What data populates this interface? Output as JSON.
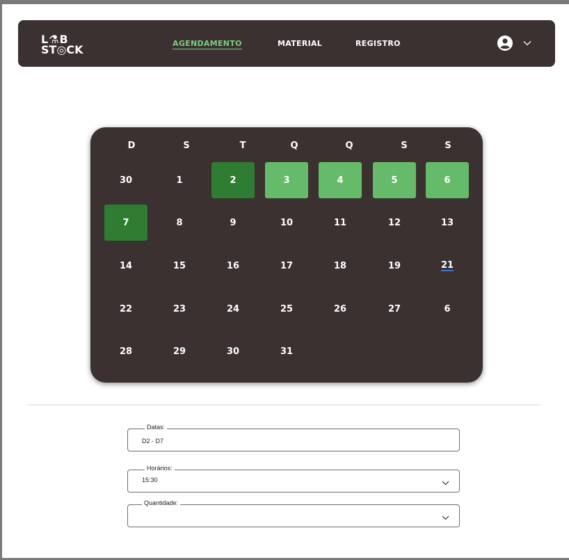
{
  "nav": {
    "logo_line1": "L⚗B",
    "logo_line2": "ST◎CK",
    "links": [
      "AGENDAMENTO",
      "MATERIAL",
      "REGISTRO"
    ]
  },
  "calendar": {
    "weekdays": [
      "D",
      "S",
      "T",
      "Q",
      "Q",
      "S",
      "S"
    ],
    "rows": [
      [
        "30",
        "1",
        "2",
        "3",
        "4",
        "5",
        "6"
      ],
      [
        "7",
        "8",
        "9",
        "10",
        "11",
        "12",
        "13"
      ],
      [
        "14",
        "15",
        "16",
        "17",
        "18",
        "19",
        "21"
      ],
      [
        "22",
        "23",
        "24",
        "25",
        "26",
        "27",
        "6"
      ],
      [
        "28",
        "29",
        "30",
        "31"
      ]
    ],
    "selected_dark": [
      "2",
      "7"
    ],
    "selected_light": [
      "3",
      "4",
      "5",
      "6"
    ],
    "colors": {
      "dark": "#2e7d32",
      "light": "#66bb6a",
      "panel": "#3a3130",
      "accent": "#7dcc83"
    }
  },
  "form": {
    "datas": {
      "label": "Datas:",
      "value": "D2 - D7"
    },
    "horarios": {
      "label": "Horários:",
      "value": "15:30"
    },
    "quantidade": {
      "label": "Quantidade:",
      "value": ""
    }
  }
}
